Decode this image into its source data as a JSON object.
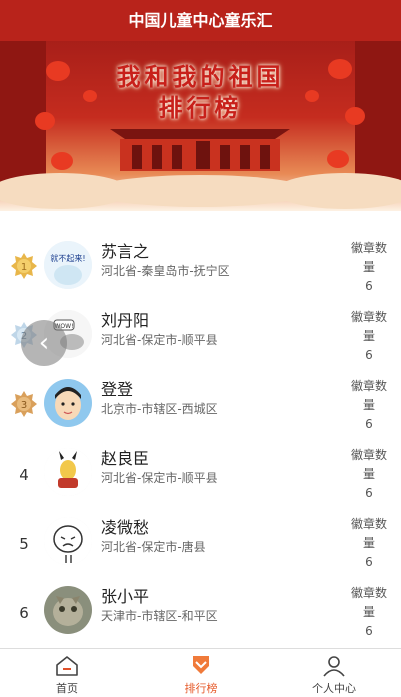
{
  "header": {
    "title": "中国儿童中心童乐汇"
  },
  "banner": {
    "line1": "我和我的祖国",
    "line2": "排行榜"
  },
  "rows": [
    {
      "rank": "1",
      "name": "苏言之",
      "location": "河北省-秦皇岛市-抚宁区",
      "badge_label": "徽章数量",
      "badge_count": "6"
    },
    {
      "rank": "2",
      "name": "刘丹阳",
      "location": "河北省-保定市-顺平县",
      "badge_label": "徽章数量",
      "badge_count": "6"
    },
    {
      "rank": "3",
      "name": "登登",
      "location": "北京市-市辖区-西城区",
      "badge_label": "徽章数量",
      "badge_count": "6"
    },
    {
      "rank": "4",
      "name": "赵良臣",
      "location": "河北省-保定市-顺平县",
      "badge_label": "徽章数量",
      "badge_count": "6"
    },
    {
      "rank": "5",
      "name": "凌微愁",
      "location": "河北省-保定市-唐县",
      "badge_label": "徽章数量",
      "badge_count": "6"
    },
    {
      "rank": "6",
      "name": "张小平",
      "location": "天津市-市辖区-和平区",
      "badge_label": "徽章数量",
      "badge_count": "6"
    }
  ],
  "avatar_texts": {
    "row1": "就不起来!",
    "row2": "WOW!"
  },
  "back_button": {
    "icon": "chevron-left-icon",
    "glyph": "‹"
  },
  "tabs": [
    {
      "label": "首页",
      "icon": "home-icon",
      "active": false
    },
    {
      "label": "排行榜",
      "icon": "medal-icon",
      "active": true
    },
    {
      "label": "个人中心",
      "icon": "person-icon",
      "active": false
    }
  ],
  "colors": {
    "brand_red": "#b8231b",
    "active_tab": "#e65a2a",
    "medal_gold": "#e8b64a",
    "medal_silver": "#bfd6e8",
    "medal_bronze": "#d9a05b"
  }
}
